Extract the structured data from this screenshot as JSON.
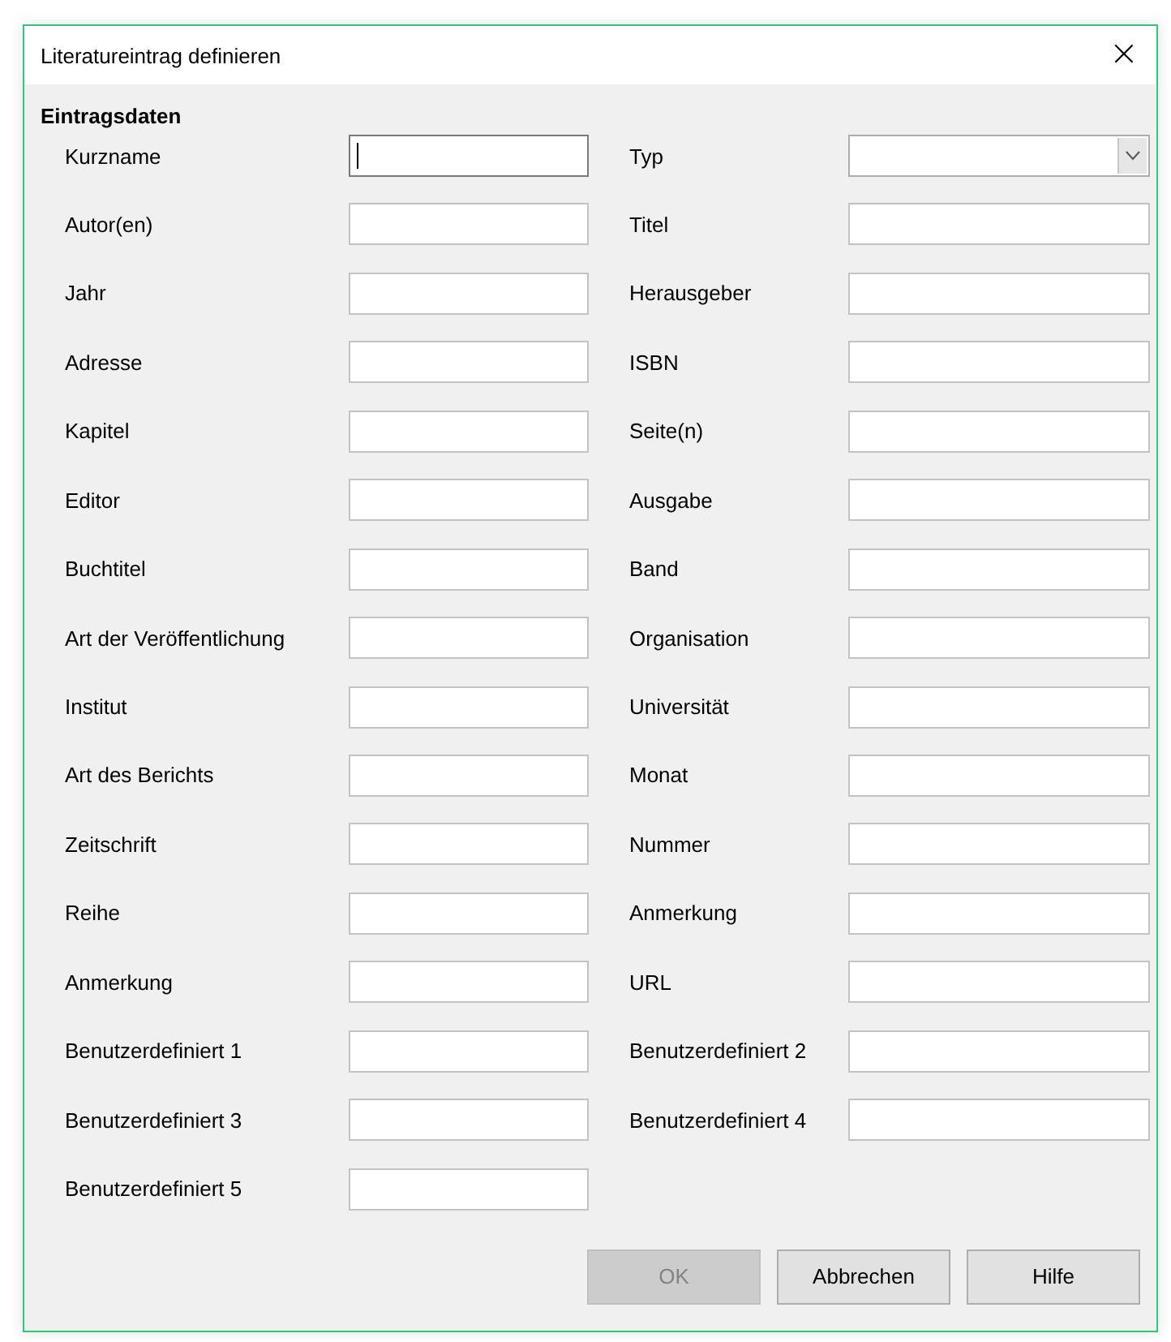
{
  "window": {
    "title": "Literatureintrag definieren",
    "close": "×"
  },
  "section": "Eintragsdaten",
  "left_fields": [
    {
      "label": "Kurzname",
      "kind": "text",
      "focused": true
    },
    {
      "label": "Autor(en)",
      "kind": "text",
      "focused": false
    },
    {
      "label": "Jahr",
      "kind": "text",
      "focused": false
    },
    {
      "label": "Adresse",
      "kind": "text",
      "focused": false
    },
    {
      "label": "Kapitel",
      "kind": "text",
      "focused": false
    },
    {
      "label": "Editor",
      "kind": "text",
      "focused": false
    },
    {
      "label": "Buchtitel",
      "kind": "text",
      "focused": false
    },
    {
      "label": "Art der Veröffentlichung",
      "kind": "text",
      "focused": false
    },
    {
      "label": "Institut",
      "kind": "text",
      "focused": false
    },
    {
      "label": "Art des Berichts",
      "kind": "text",
      "focused": false
    },
    {
      "label": "Zeitschrift",
      "kind": "text",
      "focused": false
    },
    {
      "label": "Reihe",
      "kind": "text",
      "focused": false
    },
    {
      "label": "Anmerkung",
      "kind": "text",
      "focused": false
    },
    {
      "label": "Benutzerdefiniert 1",
      "kind": "text",
      "focused": false
    },
    {
      "label": "Benutzerdefiniert 3",
      "kind": "text",
      "focused": false
    },
    {
      "label": "Benutzerdefiniert 5",
      "kind": "text",
      "focused": false
    }
  ],
  "right_fields": [
    {
      "label": "Typ",
      "kind": "dropdown",
      "focused": false
    },
    {
      "label": "Titel",
      "kind": "text",
      "focused": false
    },
    {
      "label": "Herausgeber",
      "kind": "text",
      "focused": false
    },
    {
      "label": "ISBN",
      "kind": "text",
      "focused": false
    },
    {
      "label": "Seite(n)",
      "kind": "text",
      "focused": false
    },
    {
      "label": "Ausgabe",
      "kind": "text",
      "focused": false
    },
    {
      "label": "Band",
      "kind": "text",
      "focused": false
    },
    {
      "label": "Organisation",
      "kind": "text",
      "focused": false
    },
    {
      "label": "Universität",
      "kind": "text",
      "focused": false
    },
    {
      "label": "Monat",
      "kind": "text",
      "focused": false
    },
    {
      "label": "Nummer",
      "kind": "text",
      "focused": false
    },
    {
      "label": "Anmerkung",
      "kind": "text",
      "focused": false
    },
    {
      "label": "URL",
      "kind": "text",
      "focused": false
    },
    {
      "label": "Benutzerdefiniert 2",
      "kind": "text",
      "focused": false
    },
    {
      "label": "Benutzerdefiniert 4",
      "kind": "text",
      "focused": false
    }
  ],
  "buttons": [
    {
      "label": "OK",
      "disabled": true
    },
    {
      "label": "Abbrechen",
      "disabled": false
    },
    {
      "label": "Hilfe",
      "disabled": false
    }
  ]
}
